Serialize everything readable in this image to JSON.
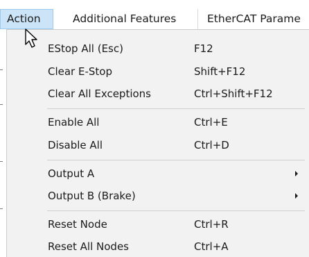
{
  "menubar": {
    "items": [
      {
        "label": "Action"
      },
      {
        "label": "Additional Features"
      },
      {
        "label": "EtherCAT Parame"
      }
    ]
  },
  "menu": {
    "items": [
      {
        "label": "EStop All (Esc)",
        "shortcut": "F12"
      },
      {
        "label": "Clear E-Stop",
        "shortcut": "Shift+F12"
      },
      {
        "label": "Clear All Exceptions",
        "shortcut": "Ctrl+Shift+F12"
      },
      {
        "label": "Enable All",
        "shortcut": "Ctrl+E"
      },
      {
        "label": "Disable All",
        "shortcut": "Ctrl+D"
      },
      {
        "label": "Output A",
        "submenu_icon": "chevron-right-icon"
      },
      {
        "label": "Output B (Brake)",
        "submenu_icon": "chevron-right-icon"
      },
      {
        "label": "Reset Node",
        "shortcut": "Ctrl+R"
      },
      {
        "label": "Reset All Nodes",
        "shortcut": "Ctrl+A"
      }
    ]
  },
  "colors": {
    "active_menu_bg": "#cce4f7",
    "active_menu_border": "#99c9ef",
    "menu_bg": "#f2f2f2",
    "text": "#1a1a1a"
  },
  "cursor": {
    "icon": "mouse-pointer-icon"
  }
}
